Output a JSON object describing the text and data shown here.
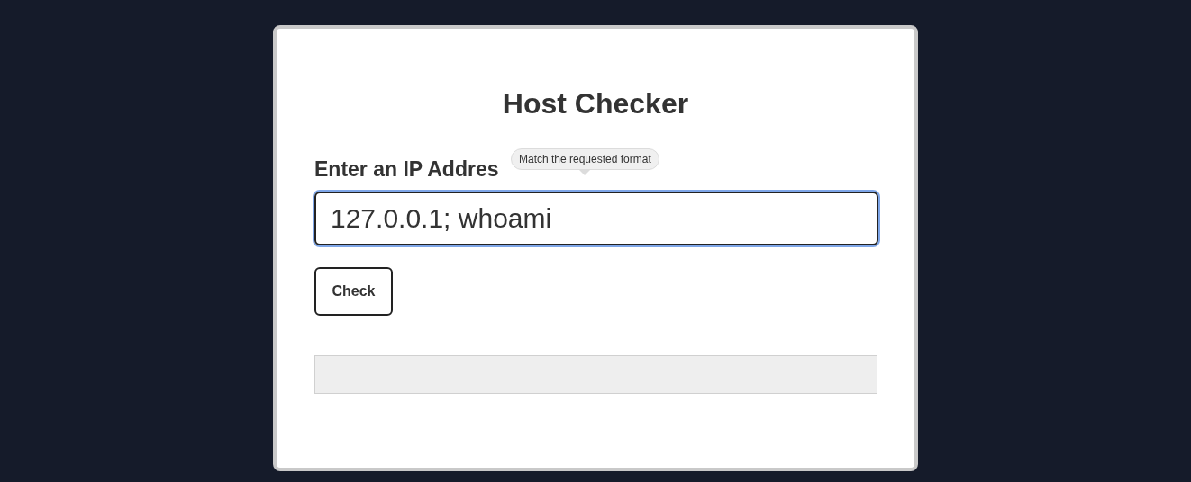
{
  "title": "Host Checker",
  "field": {
    "label": "Enter an IP Addres",
    "value": "127.0.0.1; whoami",
    "focused": true,
    "tooltip": "Match the requested format"
  },
  "button": {
    "label": "Check"
  },
  "output": {
    "kind": "empty"
  }
}
